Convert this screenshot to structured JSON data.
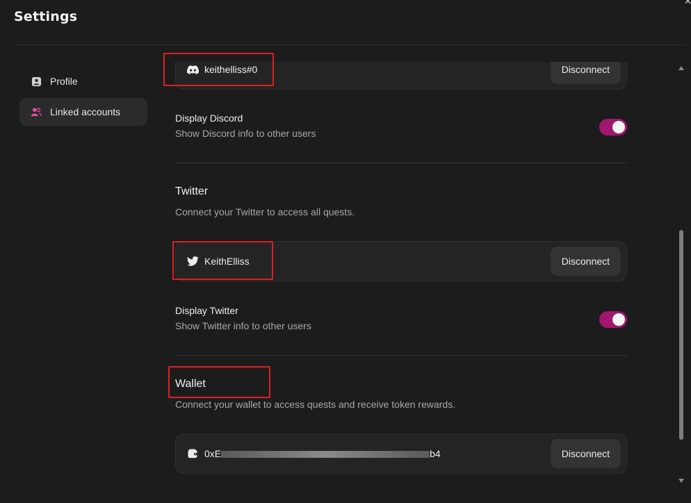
{
  "dialog": {
    "title": "Settings"
  },
  "sidebar": {
    "items": [
      {
        "label": "Profile",
        "icon": "profile-icon",
        "active": false
      },
      {
        "label": "Linked accounts",
        "icon": "users-icon",
        "active": true
      }
    ]
  },
  "discord": {
    "username": "keithelliss#0",
    "disconnect_label": "Disconnect",
    "display_title": "Display Discord",
    "display_desc": "Show Discord info to other users",
    "display_enabled": true
  },
  "twitter": {
    "title": "Twitter",
    "description": "Connect your Twitter to access all quests.",
    "username": "KeithElliss",
    "disconnect_label": "Disconnect",
    "display_title": "Display Twitter",
    "display_desc": "Show Twitter info to other users",
    "display_enabled": true
  },
  "wallet": {
    "title": "Wallet",
    "description": "Connect your wallet to access quests and receive token rewards.",
    "address_prefix": "0xE",
    "address_suffix": "b4",
    "disconnect_label": "Disconnect"
  },
  "colors": {
    "accent": "#a1176f",
    "background": "#1c1c1c",
    "card": "#242424",
    "highlight": "#e02020"
  }
}
